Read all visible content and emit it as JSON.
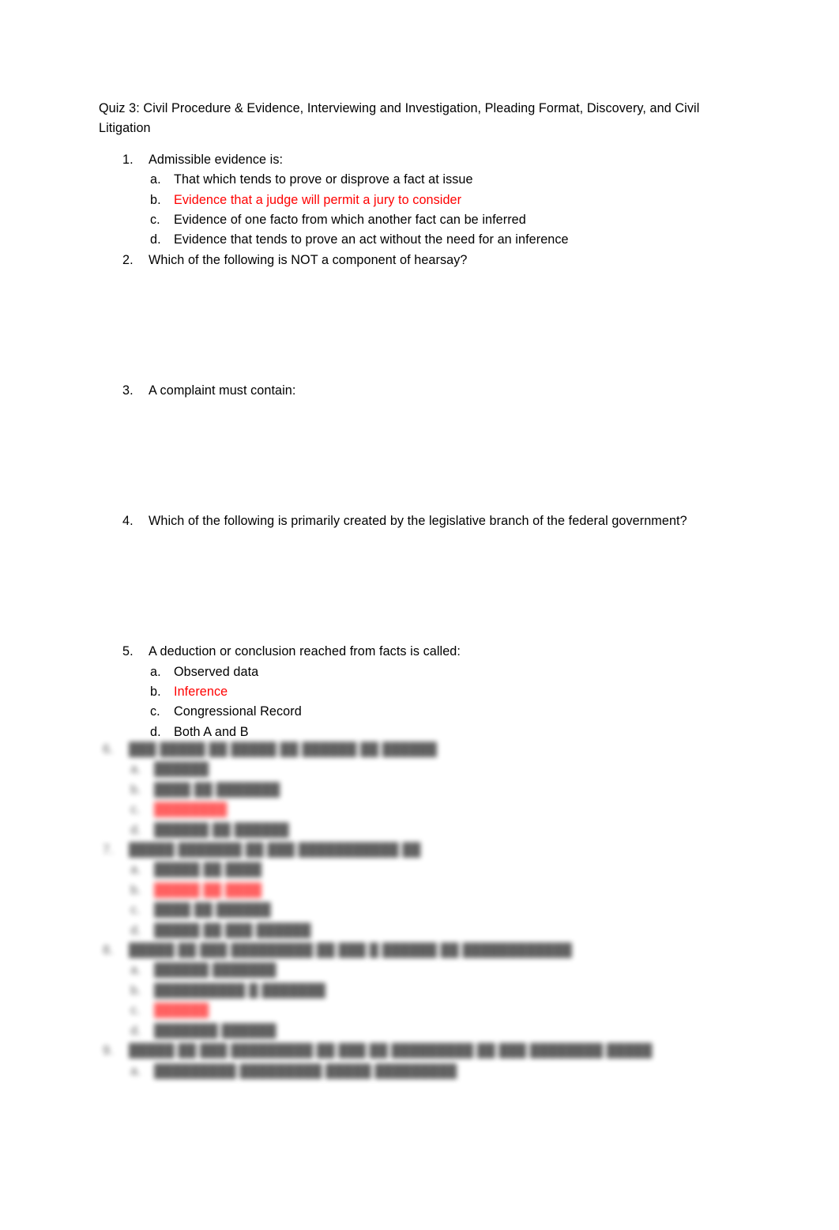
{
  "document": {
    "title": "Quiz 3: Civil Procedure & Evidence, Interviewing and Investigation, Pleading Format, Discovery, and Civil Litigation",
    "correct_answer_color": "#ff0000",
    "body_color": "#000000",
    "background_color": "#ffffff"
  },
  "questions": [
    {
      "number": "1.",
      "text": "Admissible evidence is:",
      "answers": [
        {
          "letter": "a.",
          "text": "That which tends to prove or disprove a fact at issue",
          "correct": false
        },
        {
          "letter": "b.",
          "text": "Evidence that a judge will permit a jury to consider",
          "correct": true
        },
        {
          "letter": "c.",
          "text": "Evidence of one facto from which another fact can be inferred",
          "correct": false
        },
        {
          "letter": "d.",
          "text": "Evidence that tends to prove an act without the need for an inference",
          "correct": false
        }
      ]
    },
    {
      "number": "2.",
      "text": "Which of the following is NOT a component of hearsay?",
      "answers": []
    },
    {
      "number": "3.",
      "text": "A complaint must contain:",
      "answers": []
    },
    {
      "number": "4.",
      "text": "Which of the following is primarily created by the legislative branch of the federal government?",
      "answers": []
    },
    {
      "number": "5.",
      "text": "A deduction or conclusion reached from facts is called:",
      "answers": [
        {
          "letter": "a.",
          "text": "Observed data",
          "correct": false
        },
        {
          "letter": "b.",
          "text": "Inference",
          "correct": true
        },
        {
          "letter": "c.",
          "text": "Congressional Record",
          "correct": false
        },
        {
          "letter": "d.",
          "text": "Both A and B",
          "correct": false
        }
      ]
    }
  ],
  "blurred_questions": [
    {
      "number": "6.",
      "text": "███ █████ ██ █████ ██ ██████ ██ ██████",
      "answers": [
        {
          "letter": "a.",
          "text": "██████",
          "correct": false
        },
        {
          "letter": "b.",
          "text": "████ ██ ███████",
          "correct": false
        },
        {
          "letter": "c.",
          "text": "████████",
          "correct": true
        },
        {
          "letter": "d.",
          "text": "██████ ██ ██████",
          "correct": false
        }
      ]
    },
    {
      "number": "7.",
      "text": "█████ ███████ ██ ███ ███████████ ██",
      "answers": [
        {
          "letter": "a.",
          "text": "█████ ██ ████",
          "correct": false
        },
        {
          "letter": "b.",
          "text": "█████ ██ ████",
          "correct": true
        },
        {
          "letter": "c.",
          "text": "████ ██ ██████",
          "correct": false
        },
        {
          "letter": "d.",
          "text": "█████ ██ ███ ██████",
          "correct": false
        }
      ]
    },
    {
      "number": "8.",
      "text": "█████ ██ ███ █████████ ██ ███ █ ██████ ██ ████████████",
      "answers": [
        {
          "letter": "a.",
          "text": "██████ ███████",
          "correct": false
        },
        {
          "letter": "b.",
          "text": "██████████ █ ███████",
          "correct": false
        },
        {
          "letter": "c.",
          "text": "██████",
          "correct": true
        },
        {
          "letter": "d.",
          "text": "███████ ██████",
          "correct": false
        }
      ]
    },
    {
      "number": "9.",
      "text": "█████ ██ ███ █████████ ██ ███ ██ █████████ ██ ███ ████████ █████",
      "answers": [
        {
          "letter": "a.",
          "text": "█████████ █████████ █████ █████████",
          "correct": false
        }
      ]
    }
  ]
}
